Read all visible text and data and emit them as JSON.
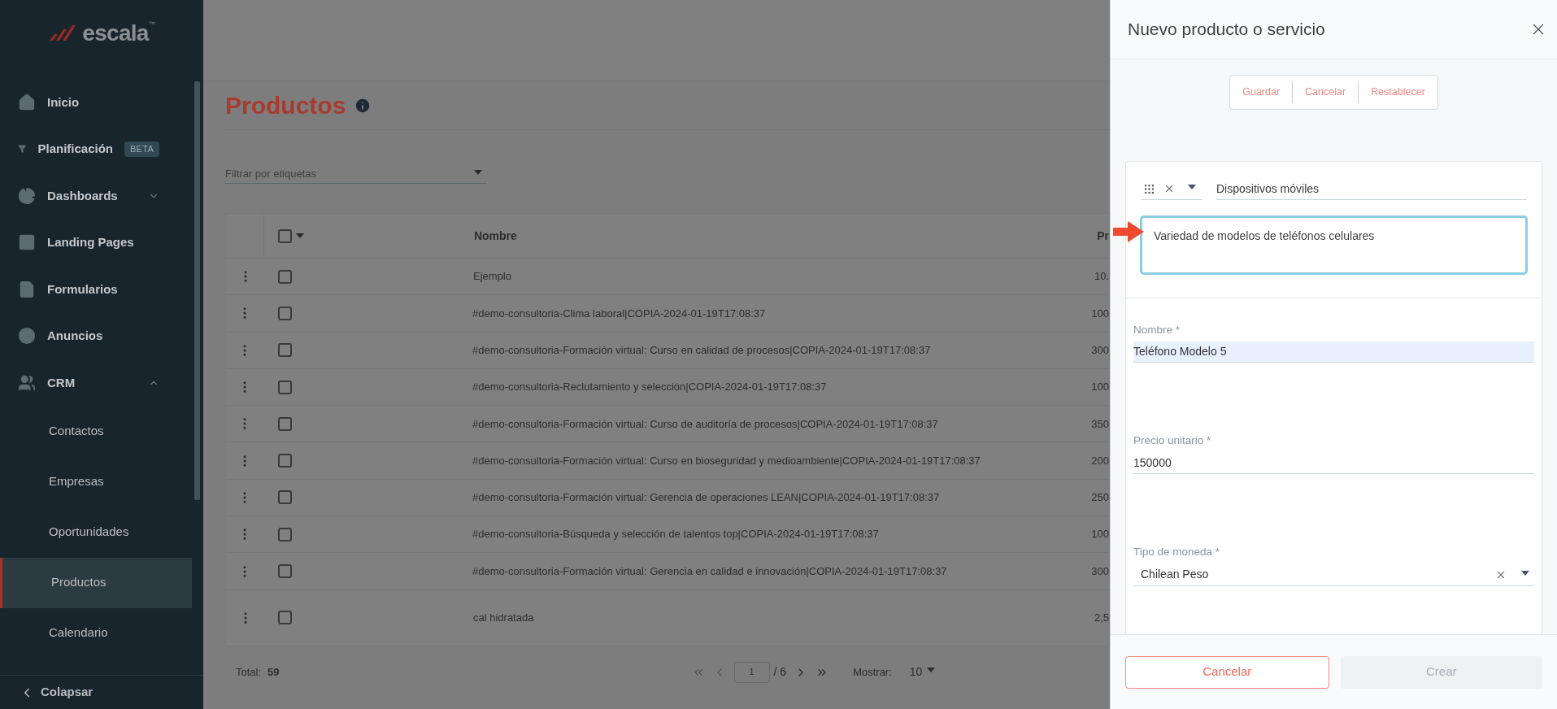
{
  "sidebar": {
    "logo": {
      "text": "escala",
      "mark": "™"
    },
    "items": [
      {
        "kind": "link",
        "label": "Inicio",
        "selected": false
      },
      {
        "kind": "link",
        "label": "Planificación",
        "badge": "BETA",
        "selected": false
      },
      {
        "kind": "group",
        "label": "Dashboards",
        "expanded": false
      },
      {
        "kind": "link",
        "label": "Landing Pages",
        "selected": false
      },
      {
        "kind": "link",
        "label": "Formularios",
        "selected": false
      },
      {
        "kind": "link",
        "label": "Anuncios",
        "selected": false
      },
      {
        "kind": "group",
        "label": "CRM",
        "expanded": true,
        "children": [
          {
            "label": "Contactos",
            "selected": false
          },
          {
            "label": "Empresas",
            "selected": false
          },
          {
            "label": "Oportunidades",
            "selected": false
          },
          {
            "label": "Productos",
            "selected": true
          },
          {
            "label": "Calendario",
            "selected": false
          }
        ]
      }
    ],
    "collapse_label": "Colapsar"
  },
  "page": {
    "title": "Productos",
    "filter": {
      "placeholder": "Filtrar por etiquetas"
    },
    "table": {
      "select_all_checked": false,
      "columns": [
        "Nombre",
        "Pr"
      ],
      "rows": [
        {
          "checked": false,
          "cells": [
            "Ejemplo",
            "10."
          ]
        },
        {
          "checked": false,
          "cells": [
            "#demo-consultoria-Clima laboral|COPIA-2024-01-19T17:08:37",
            "100"
          ]
        },
        {
          "checked": false,
          "cells": [
            "#demo-consultoria-Formación virtual: Curso en calidad de procesos|COPIA-2024-01-19T17:08:37",
            "300"
          ]
        },
        {
          "checked": false,
          "cells": [
            "#demo-consultoria-Reclutamiento y selección|COPIA-2024-01-19T17:08:37",
            "100"
          ]
        },
        {
          "checked": false,
          "cells": [
            "#demo-consultoria-Formación virtual: Curso de auditoría de procesos|COPIA-2024-01-19T17:08:37",
            "350"
          ]
        },
        {
          "checked": false,
          "cells": [
            "#demo-consultoria-Formación virtual: Curso en bioseguridad y medioambiente|COPIA-2024-01-19T17:08:37",
            "200"
          ]
        },
        {
          "checked": false,
          "cells": [
            "#demo-consultoria-Formación virtual: Gerencia de operaciones LEAN|COPIA-2024-01-19T17:08:37",
            "250"
          ]
        },
        {
          "checked": false,
          "cells": [
            "#demo-consultoria-Búsqueda y selección de talentos top|COPIA-2024-01-19T17:08:37",
            "100"
          ]
        },
        {
          "checked": false,
          "cells": [
            "#demo-consultoria-Formación virtual: Gerencia en calidad e innovación|COPIA-2024-01-19T17:08:37",
            "300"
          ]
        },
        {
          "checked": false,
          "cells": [
            "cal hidratada",
            "2,5"
          ]
        }
      ]
    },
    "footer": {
      "total_label": "Total:",
      "total": "59",
      "page": "1",
      "pages": "/ 6",
      "show_label": "Mostrar:",
      "show_value": "10"
    }
  },
  "panel": {
    "title": "Nuevo producto o servicio",
    "toolbar": [
      "Guardar",
      "Cancelar",
      "Restablecer"
    ],
    "category": "Dispositivos móviles",
    "description": {
      "value": "Variedad de modelos de teléfonos celulares",
      "focused": true
    },
    "fields": [
      {
        "kind": "text",
        "label": "Nombre *",
        "value": "Teléfono Modelo 5",
        "autofilled": true
      },
      {
        "kind": "text",
        "label": "Precio unitario *",
        "value": "150000",
        "autofilled": false
      },
      {
        "kind": "select",
        "label": "Tipo de moneda *",
        "value": "Chilean Peso"
      }
    ],
    "buttons": [
      {
        "label": "Cancelar",
        "disabled": false
      },
      {
        "label": "Crear",
        "disabled": true
      }
    ]
  }
}
